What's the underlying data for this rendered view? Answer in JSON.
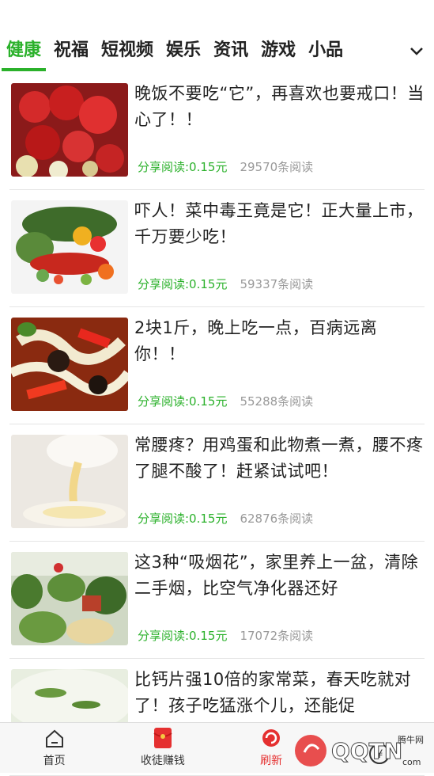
{
  "tabs": [
    "健康",
    "祝福",
    "短视频",
    "娱乐",
    "资讯",
    "游戏",
    "小品"
  ],
  "articles": [
    {
      "title": "晚饭不要吃“它”，再喜欢也要戒口！当心了！！",
      "reward": "分享阅读:0.15元",
      "reads": "29570条阅读"
    },
    {
      "title": "吓人！菜中毒王竟是它！正大量上市，千万要少吃！",
      "reward": "分享阅读:0.15元",
      "reads": "59337条阅读"
    },
    {
      "title": "2块1斤，晚上吃一点，百病远离你！！",
      "reward": "分享阅读:0.15元",
      "reads": "55288条阅读"
    },
    {
      "title": "常腰疼？用鸡蛋和此物煮一煮，腰不疼了腿不酸了！赶紧试试吧！",
      "reward": "分享阅读:0.15元",
      "reads": "62876条阅读"
    },
    {
      "title": "这3种“吸烟花”，家里养上一盆，清除二手烟，比空气净化器还好",
      "reward": "分享阅读:0.15元",
      "reads": "17072条阅读"
    },
    {
      "title": "比钙片强10倍的家常菜，春天吃就对了！孩子吃猛涨个儿，还能促",
      "reward": "",
      "reads": ""
    }
  ],
  "tabbar": {
    "home": "首页",
    "recruit": "收徒赚钱",
    "refresh": "刷新",
    "wallet": ""
  },
  "watermark": {
    "brand": "QQTN",
    "sub": "腾牛网",
    "suffix": "com"
  },
  "colors": {
    "accent": "#2bb12b",
    "refresh": "#e53030"
  }
}
